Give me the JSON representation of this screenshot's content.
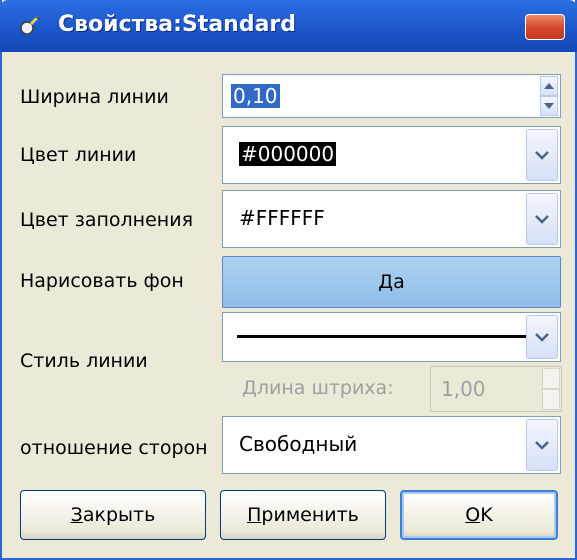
{
  "window": {
    "title": "Свойства:Standard"
  },
  "rows": {
    "line_width": {
      "label": "Ширина линии",
      "value": "0,10"
    },
    "line_color": {
      "label": "Цвет линии",
      "value": "#000000"
    },
    "fill_color": {
      "label": "Цвет заполнения",
      "value": "#FFFFFF"
    },
    "draw_background": {
      "label": "Нарисовать фон",
      "value": "Да"
    },
    "line_style": {
      "label": "Стиль линии",
      "dash_label": "Длина штриха:",
      "dash_value": "1,00"
    },
    "aspect_ratio": {
      "label": "отношение сторон",
      "value": "Свободный"
    }
  },
  "buttons": {
    "close": {
      "underlined": "З",
      "rest": "акрыть"
    },
    "apply": {
      "underlined": "П",
      "rest": "рименить"
    },
    "ok": {
      "underlined": "O",
      "rest": "K"
    }
  },
  "icons": {
    "title": "app-icon",
    "close": "close-icon",
    "dropdown": "chevron-down-icon",
    "spin_up": "spin-up-icon",
    "spin_down": "spin-down-icon"
  },
  "colors": {
    "titlebar": "#1b55c8",
    "dialog_bg": "#ece9d8",
    "toggle_active": "#aed2f2",
    "selection": "#3169c6"
  }
}
